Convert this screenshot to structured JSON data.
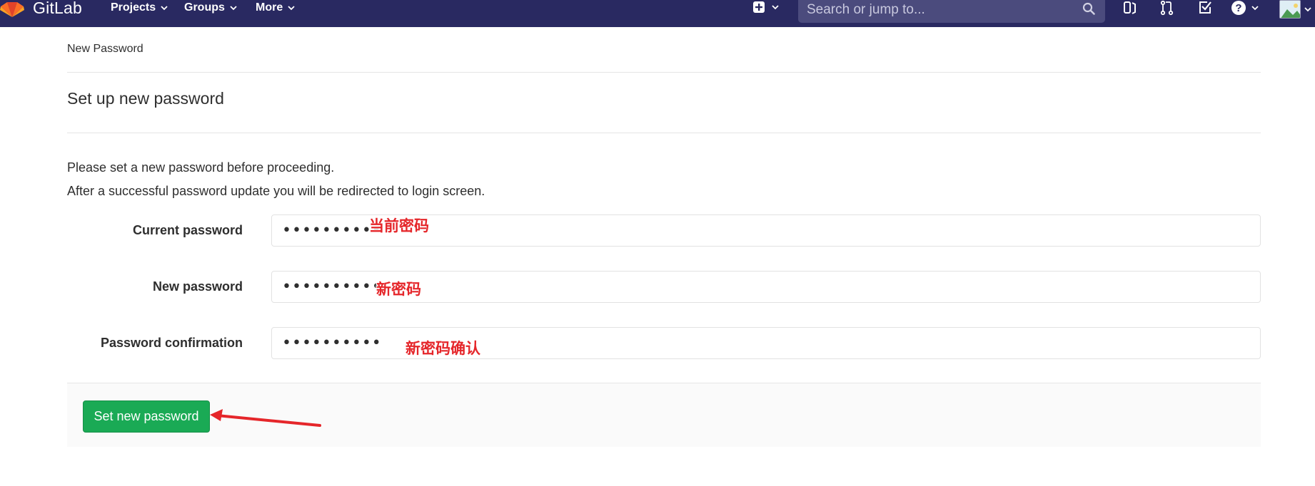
{
  "navbar": {
    "brand": "GitLab",
    "menus": [
      "Projects",
      "Groups",
      "More"
    ],
    "search_placeholder": "Search or jump to...",
    "icons": [
      "plus-square-icon",
      "issues-icon",
      "merge-request-icon",
      "todo-icon",
      "help-icon",
      "avatar"
    ]
  },
  "breadcrumb": "New Password",
  "page_title": "Set up new password",
  "info": {
    "line1": "Please set a new password before proceeding.",
    "line2": "After a successful password update you will be redirected to login screen."
  },
  "form": {
    "current_password": {
      "label": "Current password",
      "value": "••••••••••",
      "annotation": "当前密码"
    },
    "new_password": {
      "label": "New password",
      "value": "••••••••••",
      "annotation": "新密码"
    },
    "password_confirmation": {
      "label": "Password confirmation",
      "value": "••••••••••",
      "annotation": "新密码确认"
    },
    "submit_label": "Set new password"
  },
  "colors": {
    "navbar": "#292961",
    "submit": "#1aaa55",
    "annotation": "#e5262a"
  }
}
